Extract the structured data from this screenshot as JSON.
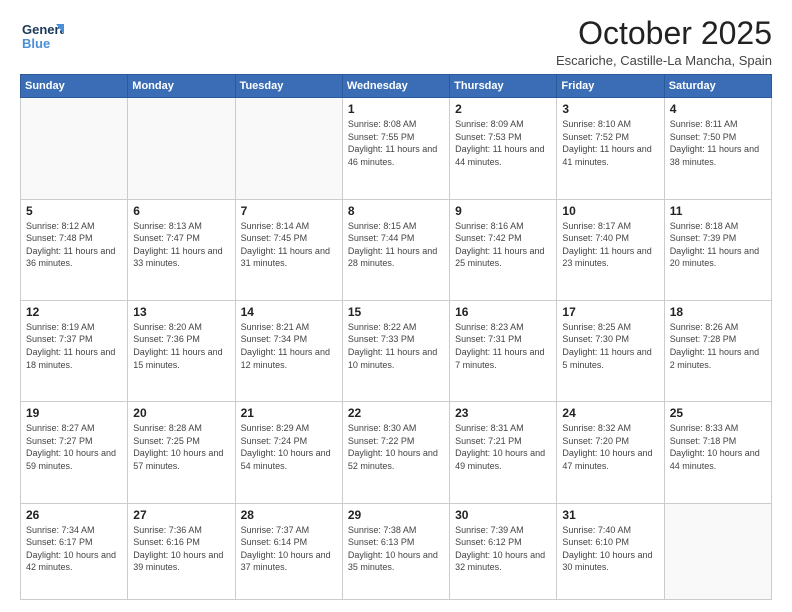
{
  "logo": {
    "line1": "General",
    "line2": "Blue"
  },
  "header": {
    "title": "October 2025",
    "subtitle": "Escariche, Castille-La Mancha, Spain"
  },
  "weekdays": [
    "Sunday",
    "Monday",
    "Tuesday",
    "Wednesday",
    "Thursday",
    "Friday",
    "Saturday"
  ],
  "days": [
    {
      "date": "",
      "info": ""
    },
    {
      "date": "",
      "info": ""
    },
    {
      "date": "",
      "info": ""
    },
    {
      "date": "1",
      "info": "Sunrise: 8:08 AM\nSunset: 7:55 PM\nDaylight: 11 hours and 46 minutes."
    },
    {
      "date": "2",
      "info": "Sunrise: 8:09 AM\nSunset: 7:53 PM\nDaylight: 11 hours and 44 minutes."
    },
    {
      "date": "3",
      "info": "Sunrise: 8:10 AM\nSunset: 7:52 PM\nDaylight: 11 hours and 41 minutes."
    },
    {
      "date": "4",
      "info": "Sunrise: 8:11 AM\nSunset: 7:50 PM\nDaylight: 11 hours and 38 minutes."
    },
    {
      "date": "5",
      "info": "Sunrise: 8:12 AM\nSunset: 7:48 PM\nDaylight: 11 hours and 36 minutes."
    },
    {
      "date": "6",
      "info": "Sunrise: 8:13 AM\nSunset: 7:47 PM\nDaylight: 11 hours and 33 minutes."
    },
    {
      "date": "7",
      "info": "Sunrise: 8:14 AM\nSunset: 7:45 PM\nDaylight: 11 hours and 31 minutes."
    },
    {
      "date": "8",
      "info": "Sunrise: 8:15 AM\nSunset: 7:44 PM\nDaylight: 11 hours and 28 minutes."
    },
    {
      "date": "9",
      "info": "Sunrise: 8:16 AM\nSunset: 7:42 PM\nDaylight: 11 hours and 25 minutes."
    },
    {
      "date": "10",
      "info": "Sunrise: 8:17 AM\nSunset: 7:40 PM\nDaylight: 11 hours and 23 minutes."
    },
    {
      "date": "11",
      "info": "Sunrise: 8:18 AM\nSunset: 7:39 PM\nDaylight: 11 hours and 20 minutes."
    },
    {
      "date": "12",
      "info": "Sunrise: 8:19 AM\nSunset: 7:37 PM\nDaylight: 11 hours and 18 minutes."
    },
    {
      "date": "13",
      "info": "Sunrise: 8:20 AM\nSunset: 7:36 PM\nDaylight: 11 hours and 15 minutes."
    },
    {
      "date": "14",
      "info": "Sunrise: 8:21 AM\nSunset: 7:34 PM\nDaylight: 11 hours and 12 minutes."
    },
    {
      "date": "15",
      "info": "Sunrise: 8:22 AM\nSunset: 7:33 PM\nDaylight: 11 hours and 10 minutes."
    },
    {
      "date": "16",
      "info": "Sunrise: 8:23 AM\nSunset: 7:31 PM\nDaylight: 11 hours and 7 minutes."
    },
    {
      "date": "17",
      "info": "Sunrise: 8:25 AM\nSunset: 7:30 PM\nDaylight: 11 hours and 5 minutes."
    },
    {
      "date": "18",
      "info": "Sunrise: 8:26 AM\nSunset: 7:28 PM\nDaylight: 11 hours and 2 minutes."
    },
    {
      "date": "19",
      "info": "Sunrise: 8:27 AM\nSunset: 7:27 PM\nDaylight: 10 hours and 59 minutes."
    },
    {
      "date": "20",
      "info": "Sunrise: 8:28 AM\nSunset: 7:25 PM\nDaylight: 10 hours and 57 minutes."
    },
    {
      "date": "21",
      "info": "Sunrise: 8:29 AM\nSunset: 7:24 PM\nDaylight: 10 hours and 54 minutes."
    },
    {
      "date": "22",
      "info": "Sunrise: 8:30 AM\nSunset: 7:22 PM\nDaylight: 10 hours and 52 minutes."
    },
    {
      "date": "23",
      "info": "Sunrise: 8:31 AM\nSunset: 7:21 PM\nDaylight: 10 hours and 49 minutes."
    },
    {
      "date": "24",
      "info": "Sunrise: 8:32 AM\nSunset: 7:20 PM\nDaylight: 10 hours and 47 minutes."
    },
    {
      "date": "25",
      "info": "Sunrise: 8:33 AM\nSunset: 7:18 PM\nDaylight: 10 hours and 44 minutes."
    },
    {
      "date": "26",
      "info": "Sunrise: 7:34 AM\nSunset: 6:17 PM\nDaylight: 10 hours and 42 minutes."
    },
    {
      "date": "27",
      "info": "Sunrise: 7:36 AM\nSunset: 6:16 PM\nDaylight: 10 hours and 39 minutes."
    },
    {
      "date": "28",
      "info": "Sunrise: 7:37 AM\nSunset: 6:14 PM\nDaylight: 10 hours and 37 minutes."
    },
    {
      "date": "29",
      "info": "Sunrise: 7:38 AM\nSunset: 6:13 PM\nDaylight: 10 hours and 35 minutes."
    },
    {
      "date": "30",
      "info": "Sunrise: 7:39 AM\nSunset: 6:12 PM\nDaylight: 10 hours and 32 minutes."
    },
    {
      "date": "31",
      "info": "Sunrise: 7:40 AM\nSunset: 6:10 PM\nDaylight: 10 hours and 30 minutes."
    },
    {
      "date": "",
      "info": ""
    }
  ]
}
